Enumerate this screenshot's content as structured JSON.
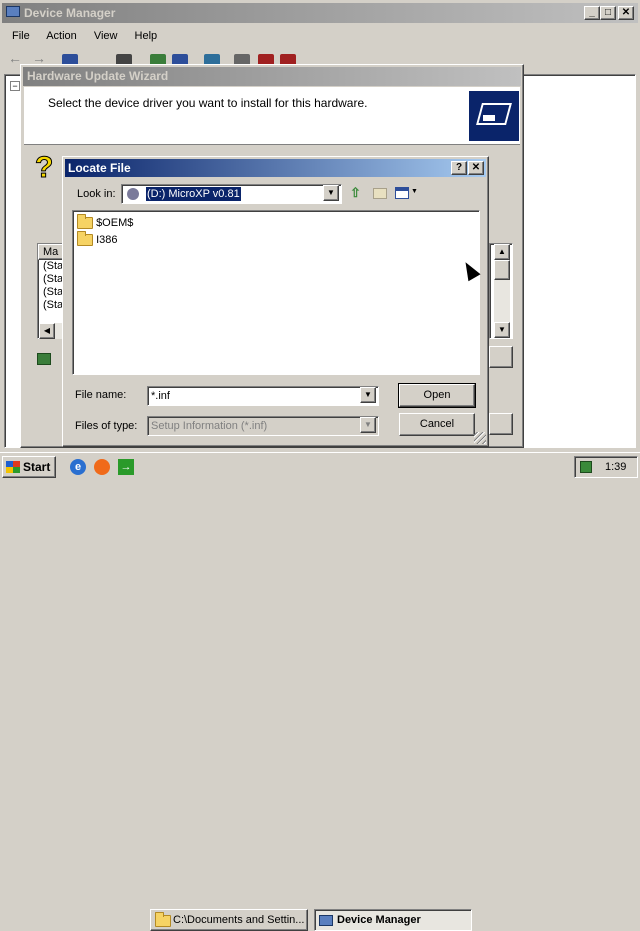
{
  "device_manager": {
    "title": "Device Manager",
    "menu": [
      "File",
      "Action",
      "View",
      "Help"
    ],
    "min_btn": "_",
    "max_btn": "□",
    "close_btn": "✕"
  },
  "wizard": {
    "title": "Hardware Update Wizard",
    "heading": "Select the device driver you want to install for this hardware.",
    "list_header": "Ma",
    "list_items": [
      "(Sta",
      "(Sta",
      "(Sta",
      "(Sta",
      "(Sta"
    ]
  },
  "locate": {
    "title": "Locate File",
    "help_btn": "?",
    "close_btn": "✕",
    "look_in_label": "Look in:",
    "look_in_value": "(D:) MicroXP v0.81",
    "items": [
      "$OEM$",
      "I386"
    ],
    "file_name_label": "File name:",
    "file_name_value": "*.inf",
    "file_type_label": "Files of type:",
    "file_type_value": "Setup Information (*.inf)",
    "open_label": "Open",
    "cancel_label": "Cancel"
  },
  "taskbar": {
    "start_label": "Start",
    "tasks": [
      "C:\\Documents and Settin...",
      "Device Manager"
    ],
    "clock": "1:39"
  },
  "colors": {
    "active_title": "#0a246a",
    "inactive_title": "#808080",
    "face": "#d4d0c8"
  }
}
